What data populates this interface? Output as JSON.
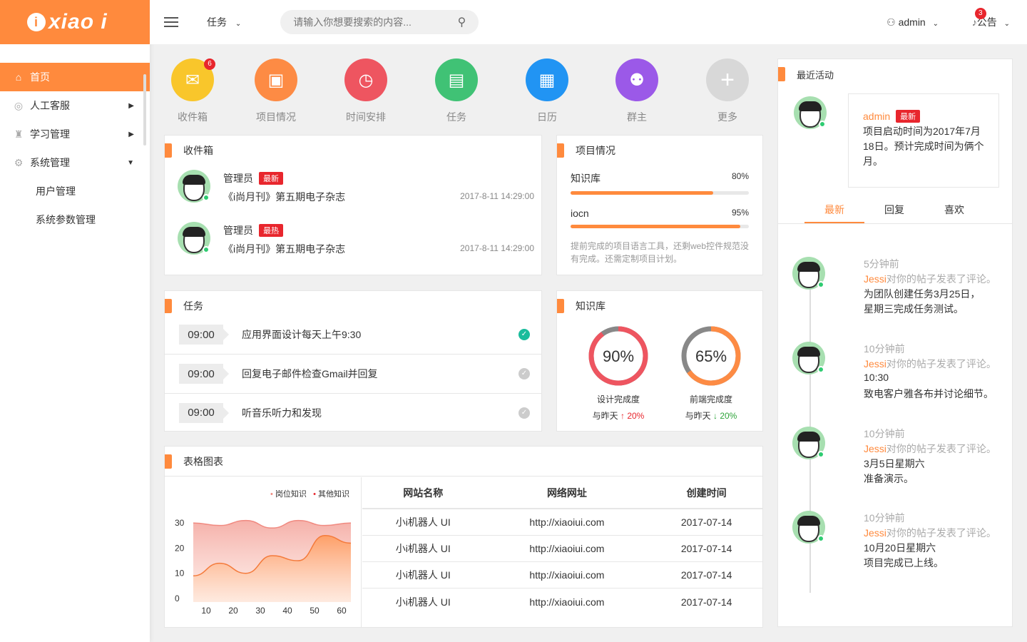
{
  "brand": {
    "logo_text": "xiao i"
  },
  "sidebar": {
    "items": [
      {
        "label": "首页",
        "icon": "home-icon",
        "active": true
      },
      {
        "label": "人工客服",
        "icon": "headset-icon"
      },
      {
        "label": "学习管理",
        "icon": "graduation-cap-icon"
      },
      {
        "label": "系统管理",
        "icon": "gear-icon"
      }
    ],
    "subitems": [
      "用户管理",
      "系统参数管理"
    ]
  },
  "topbar": {
    "task_menu": "任务",
    "search_placeholder": "请输入你想要搜索的内容...",
    "user": "admin",
    "notice_label": "公告",
    "notice_count": "3"
  },
  "quicknav": [
    {
      "label": "收件箱",
      "icon": "mail-icon",
      "color": "#f9c62b",
      "badge": "6"
    },
    {
      "label": "项目情况",
      "icon": "briefcase-icon",
      "color": "#fd8b44"
    },
    {
      "label": "时间安排",
      "icon": "alarm-clock-icon",
      "color": "#ee5560"
    },
    {
      "label": "任务",
      "icon": "document-icon",
      "color": "#40c275"
    },
    {
      "label": "日历",
      "icon": "calendar-icon",
      "color": "#2194f3"
    },
    {
      "label": "群主",
      "icon": "group-icon",
      "color": "#9b59e8"
    },
    {
      "label": "更多",
      "icon": "plus-icon",
      "color": "#d8d8d8"
    }
  ],
  "inbox": {
    "title": "收件箱",
    "messages": [
      {
        "name": "管理员",
        "tag": "最新",
        "text": "《i尚月刊》第五期电子杂志",
        "date": "2017-8-11  14:29:00"
      },
      {
        "name": "管理员",
        "tag": "最热",
        "text": "《i尚月刊》第五期电子杂志",
        "date": "2017-8-11  14:29:00"
      }
    ]
  },
  "project": {
    "title": "项目情况",
    "bars": [
      {
        "name": "知识库",
        "value": 0.8,
        "label": "80%"
      },
      {
        "name": "iocn",
        "value": 0.95,
        "label": "95%"
      }
    ],
    "note": "提前完成的项目语言工具，还剩web控件规范没有完成。还需定制项目计划。"
  },
  "tasks": {
    "title": "任务",
    "items": [
      {
        "time": "09:00",
        "text": "应用界面设计每天上午9:30",
        "done": true
      },
      {
        "time": "09:00",
        "text": "回复电子邮件检查Gmail并回复",
        "done": false
      },
      {
        "time": "09:00",
        "text": "听音乐听力和发现",
        "done": false
      }
    ]
  },
  "knowledge": {
    "title": "知识库",
    "rings": [
      {
        "value": 0.9,
        "label": "90%",
        "name": "设计完成度",
        "compare": "与昨天",
        "delta": "20%",
        "dir": "up",
        "color": "#ee5560"
      },
      {
        "value": 0.65,
        "label": "65%",
        "name": "前端完成度",
        "compare": "与昨天",
        "delta": "20%",
        "dir": "down",
        "color": "#fd8b44"
      }
    ]
  },
  "tablechart": {
    "title": "表格图表",
    "chart_data": {
      "type": "area",
      "x": [
        10,
        20,
        30,
        40,
        50,
        60
      ],
      "ylim": [
        0,
        30
      ],
      "yticks": [
        "30",
        "20",
        "10",
        "0"
      ],
      "xticks": [
        "10",
        "20",
        "30",
        "40",
        "50",
        "60"
      ],
      "series": [
        {
          "name": "岗位知识",
          "color": "#f4a8a0",
          "values": [
            30,
            29,
            31,
            28,
            31,
            29,
            30
          ]
        },
        {
          "name": "其他知识",
          "color": "#ff9a5a",
          "values": [
            9,
            14,
            10,
            17,
            15,
            25,
            22
          ]
        }
      ],
      "legend": "top-right"
    },
    "table": {
      "headers": [
        "网站名称",
        "网络网址",
        "创建时间"
      ],
      "rows": [
        [
          "小i机器人 UI",
          "http://xiaoiui.com",
          "2017-07-14"
        ],
        [
          "小i机器人 UI",
          "http://xiaoiui.com",
          "2017-07-14"
        ],
        [
          "小i机器人 UI",
          "http://xiaoiui.com",
          "2017-07-14"
        ],
        [
          "小i机器人 UI",
          "http://xiaoiui.com",
          "2017-07-14"
        ]
      ]
    }
  },
  "activity": {
    "title": "最近活动",
    "featured": {
      "name": "admin",
      "tag": "最新",
      "text": "项目启动时间为2017年7月18日。预计完成时间为俩个月。"
    },
    "tabs": [
      "最新",
      "回复",
      "喜欢"
    ],
    "items": [
      {
        "time": "5分钟前",
        "user": "Jessi",
        "action": "对你的帖子发表了评论。",
        "line1": "为团队创建任务3月25日，",
        "line2": "星期三完成任务测试。"
      },
      {
        "time": "10分钟前",
        "user": "Jessi",
        "action": "对你的帖子发表了评论。",
        "line1": "10:30",
        "line2": "致电客户雅各布并讨论细节。"
      },
      {
        "time": "10分钟前",
        "user": "Jessi",
        "action": "对你的帖子发表了评论。",
        "line1": "3月5日星期六",
        "line2": "准备演示。"
      },
      {
        "time": "10分钟前",
        "user": "Jessi",
        "action": "对你的帖子发表了评论。",
        "line1": "10月20日星期六",
        "line2": "项目完成已上线。"
      }
    ]
  }
}
